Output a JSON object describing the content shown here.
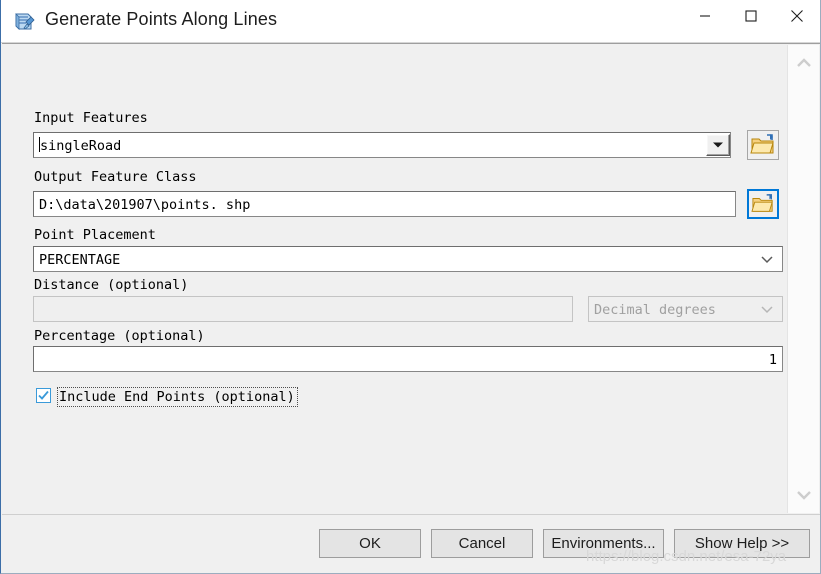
{
  "window": {
    "title": "Generate Points Along Lines",
    "icon": "script-tool-icon",
    "controls": {
      "minimize": "minimize-icon",
      "maximize": "maximize-icon",
      "close": "close-icon"
    }
  },
  "form": {
    "input_features": {
      "label": "Input Features",
      "value": "singleRoad",
      "browse_icon": "open-folder-icon",
      "dropdown_icon": "dropdown-triangle-icon"
    },
    "output_feature_class": {
      "label": "Output Feature Class",
      "value": "D:\\data\\201907\\points. shp",
      "browse_icon": "open-folder-icon"
    },
    "point_placement": {
      "label": "Point Placement",
      "value": "PERCENTAGE",
      "dropdown_icon": "chevron-down-icon"
    },
    "distance": {
      "label": "Distance (optional)",
      "value": "",
      "units_value": "Decimal degrees",
      "units_dropdown_icon": "chevron-down-icon",
      "disabled": true
    },
    "percentage": {
      "label": "Percentage (optional)",
      "value": "1"
    },
    "include_end_points": {
      "label": "Include End Points (optional)",
      "checked": true,
      "check_icon": "checkmark-icon"
    }
  },
  "scrollbar": {
    "up_icon": "chevron-up-icon",
    "down_icon": "chevron-down-icon"
  },
  "footer": {
    "ok": "OK",
    "cancel": "Cancel",
    "environments": "Environments...",
    "show_help": "Show Help >>"
  },
  "watermark": {
    "text": "https://blog.csdn.net/esa-72ya"
  },
  "colors": {
    "accent": "#0078d7",
    "check": "#3a9ad9",
    "dialog_bg": "#f0f0f0",
    "field_bg": "#ffffff"
  }
}
